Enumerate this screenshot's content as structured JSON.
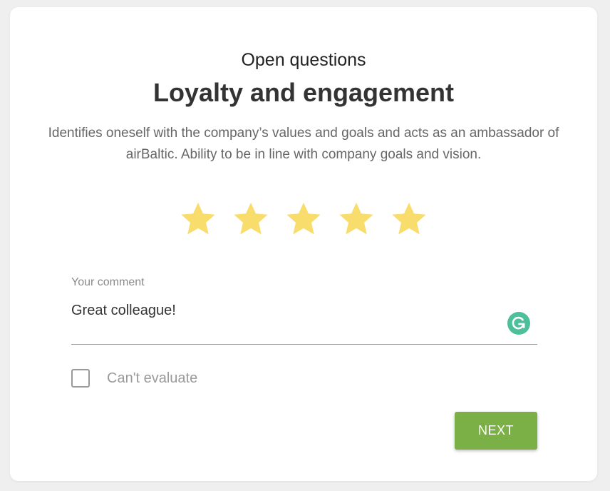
{
  "header": {
    "eyebrow": "Open questions",
    "title": "Loyalty and engagement",
    "description": "Identifies oneself with the company’s values and goals and acts as an ambassador of airBaltic. Ability to be in line with company goals and vision."
  },
  "rating": {
    "value": 5,
    "max": 5,
    "star_color": "#f8dc6c",
    "icon": "star-icon"
  },
  "comment": {
    "label": "Your comment",
    "value": "Great colleague!",
    "icon": "grammarly-icon"
  },
  "cant_evaluate": {
    "label": "Can't evaluate",
    "checked": false
  },
  "next_button": {
    "label": "NEXT",
    "color": "#7bb046"
  }
}
